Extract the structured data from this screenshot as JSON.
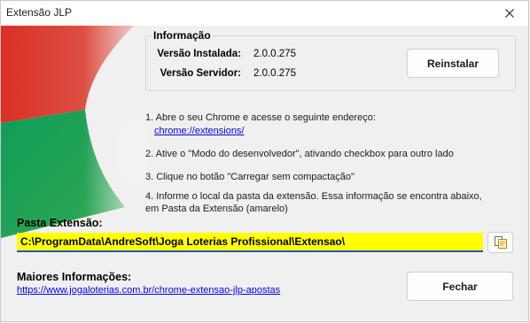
{
  "window": {
    "title": "Extensão JLP"
  },
  "info": {
    "legend": "Informação",
    "installed_label": "Versão Instalada:",
    "installed_value": "2.0.0.275",
    "server_label": "Versão Servidor:",
    "server_value": "2.0.0.275",
    "reinstall_label": "Reinstalar"
  },
  "instructions": {
    "step1_line1": "1. Abre o seu Chrome e acesse o seguinte endereço:",
    "step1_link": "chrome://extensions/",
    "step2": "2. Ative o \"Modo do desenvolvedor\", ativando checkbox para outro lado",
    "step3": "3. Clique no botão \"Carregar sem compactação\"",
    "step4_line1": "4. Informe o local da pasta da extensão. Essa informação se encontra abaixo,",
    "step4_line2": "em Pasta da Extensão (amarelo)"
  },
  "pasta": {
    "label": "Pasta Extensão:",
    "value": "C:\\ProgramData\\AndreSoft\\Joga Loterias Profissional\\Extensao\\"
  },
  "more": {
    "label": "Maiores Informações:",
    "link": "https://www.jogaloterias.com.br/chrome-extensao-jlp-apostas"
  },
  "footer": {
    "close_label": "Fechar"
  },
  "icons": {
    "close": "close-icon",
    "browse": "copy-folder-icon"
  },
  "colors": {
    "path_background": "#ffff00",
    "link": "#0000ee",
    "logo_red": "#db4437",
    "logo_green": "#0f9d58"
  }
}
